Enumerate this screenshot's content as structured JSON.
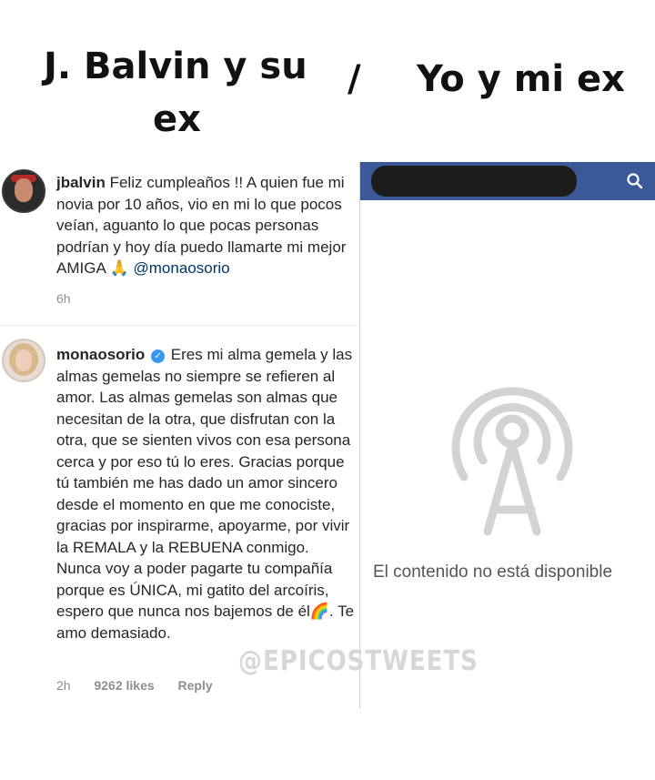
{
  "header": {
    "left_line1": "J. Balvin y su",
    "left_line2": "ex",
    "divider": "/",
    "right": "Yo y mi ex"
  },
  "comment1": {
    "username": "jbalvin",
    "text": "Feliz cumpleaños !! A quien fue mi novia por 10 años, vio en mi lo que pocos veían, aguanto lo que pocas personas podrían y hoy día puedo llamarte mi mejor AMIGA",
    "emoji": "🙏",
    "mention": "@monaosorio",
    "time": "6h"
  },
  "comment2": {
    "username": "monaosorio",
    "text": "Eres mi alma gemela y las almas gemelas no siempre se refieren al amor. Las almas gemelas son almas que necesitan de la otra, que disfrutan con la otra, que se sienten vivos con esa persona cerca y por eso tú lo eres. Gracias porque tú también me has dado un amor sincero desde el momento en que me conociste, gracias por inspirarme, apoyarme, por vivir la REMALA y la REBUENA conmigo. Nunca voy a poder pagarte tu compañía porque es ÚNICA, mi gatito del arcoíris, espero que nunca nos bajemos de él",
    "emoji": "🌈",
    "text_end": ". Te amo demasiado.",
    "time": "2h",
    "likes": "9262 likes",
    "reply": "Reply"
  },
  "facebook": {
    "unavailable_message": "El contenido no está disponible",
    "icons": [
      "search-icon",
      "broadcast-antenna-icon"
    ],
    "colors": {
      "bar": "#3b5998",
      "antenna": "#d3d3d3"
    }
  },
  "watermark": "@EPICOSTWEETS"
}
